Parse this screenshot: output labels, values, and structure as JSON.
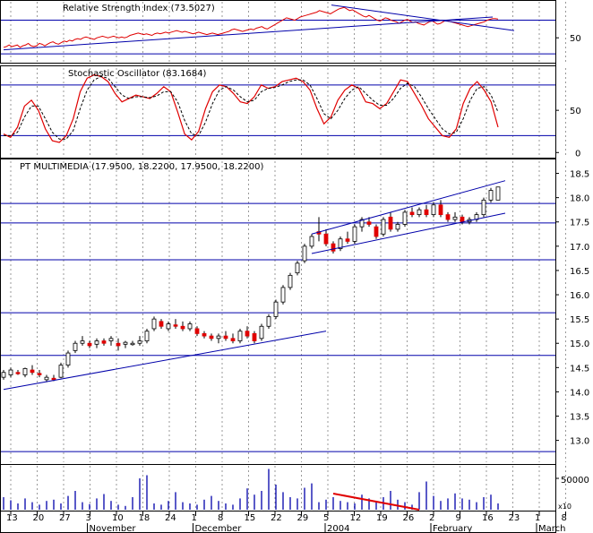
{
  "chart_data": {
    "type": "candlestick",
    "panels": {
      "rsi": {
        "title": "Relative Strength Index (73.5027)",
        "ylim": [
          20,
          95
        ],
        "ticks": [
          50
        ],
        "hlines": [
          72,
          30
        ],
        "values": [
          38,
          39,
          41,
          39,
          40,
          41,
          38,
          40,
          41,
          43,
          40,
          39,
          40,
          43,
          42,
          40,
          42,
          44,
          45,
          43,
          42,
          44,
          46,
          45,
          47,
          46,
          48,
          49,
          48,
          50,
          51,
          50,
          49,
          48,
          50,
          51,
          52,
          51,
          50,
          51,
          52,
          51,
          50,
          51,
          50,
          51,
          53,
          54,
          55,
          56,
          55,
          54,
          55,
          54,
          53,
          55,
          56,
          55,
          56,
          57,
          56,
          57,
          58,
          59,
          58,
          57,
          58,
          57,
          56,
          55,
          56,
          57,
          56,
          55,
          54,
          55,
          56,
          55,
          54,
          55,
          56,
          57,
          58,
          60,
          61,
          60,
          59,
          58,
          59,
          60,
          61,
          60,
          62,
          63,
          64,
          62,
          61,
          63,
          65,
          67,
          69,
          71,
          73,
          75,
          74,
          73,
          72,
          74,
          76,
          77,
          78,
          79,
          80,
          81,
          82,
          84,
          83,
          82,
          81,
          80,
          82,
          84,
          86,
          87,
          88,
          86,
          84,
          85,
          83,
          81,
          79,
          77,
          76,
          78,
          76,
          74,
          72,
          71,
          73,
          75,
          74,
          72,
          71,
          70,
          68,
          70,
          72,
          73,
          71,
          69,
          70,
          68,
          67,
          66,
          68,
          70,
          71,
          69,
          67,
          68,
          70,
          72,
          71,
          70,
          69,
          68,
          67,
          66,
          65,
          64,
          65,
          66,
          67,
          68,
          69,
          70,
          72,
          73,
          74,
          74,
          73.5
        ]
      },
      "stochastic": {
        "title": "Stochastic Oscillator (83.1684)",
        "ylim": [
          -5,
          100
        ],
        "ticks": [
          50,
          0
        ],
        "hlines": [
          80,
          20
        ],
        "k": [
          22,
          18,
          30,
          55,
          62,
          50,
          28,
          14,
          12,
          20,
          40,
          72,
          88,
          92,
          90,
          84,
          70,
          60,
          64,
          68,
          66,
          64,
          70,
          78,
          72,
          48,
          22,
          15,
          25,
          52,
          72,
          80,
          78,
          70,
          60,
          58,
          66,
          80,
          76,
          78,
          84,
          86,
          88,
          84,
          74,
          52,
          34,
          42,
          62,
          74,
          80,
          76,
          60,
          58,
          52,
          58,
          72,
          86,
          84,
          70,
          56,
          40,
          30,
          20,
          18,
          28,
          58,
          76,
          84,
          74,
          60,
          30
        ],
        "d": [
          20,
          20,
          24,
          42,
          55,
          55,
          40,
          24,
          16,
          16,
          26,
          52,
          74,
          86,
          90,
          88,
          78,
          68,
          64,
          66,
          66,
          65,
          67,
          72,
          72,
          60,
          38,
          22,
          20,
          36,
          58,
          74,
          78,
          74,
          66,
          60,
          62,
          72,
          76,
          77,
          80,
          84,
          86,
          86,
          80,
          64,
          46,
          40,
          50,
          64,
          74,
          78,
          70,
          62,
          56,
          56,
          64,
          76,
          82,
          78,
          66,
          52,
          40,
          28,
          22,
          24,
          40,
          62,
          76,
          78,
          68,
          48
        ]
      },
      "price": {
        "title": "PT MULTIMEDIA (17.9500, 18.2200, 17.9500, 18.2200)",
        "ylim": [
          12.55,
          18.75
        ],
        "ticks": [
          18.5,
          18.0,
          17.5,
          17.0,
          16.5,
          16.0,
          15.5,
          15.0,
          14.5,
          14.0,
          13.5,
          13.0
        ],
        "hlines": [
          17.88,
          17.48,
          16.72,
          15.63,
          14.75,
          12.77
        ],
        "ohlc": [
          [
            14.3,
            14.45,
            14.25,
            14.4
          ],
          [
            14.35,
            14.5,
            14.3,
            14.45
          ],
          [
            14.4,
            14.45,
            14.35,
            14.38
          ],
          [
            14.35,
            14.5,
            14.3,
            14.48
          ],
          [
            14.45,
            14.55,
            14.35,
            14.4
          ],
          [
            14.38,
            14.45,
            14.3,
            14.35
          ],
          [
            14.25,
            14.35,
            14.2,
            14.3
          ],
          [
            14.28,
            14.35,
            14.22,
            14.25
          ],
          [
            14.3,
            14.6,
            14.28,
            14.55
          ],
          [
            14.55,
            14.85,
            14.5,
            14.8
          ],
          [
            14.85,
            15.05,
            14.8,
            15.0
          ],
          [
            15.0,
            15.15,
            14.95,
            15.05
          ],
          [
            15.0,
            15.05,
            14.9,
            14.95
          ],
          [
            14.98,
            15.1,
            14.9,
            15.05
          ],
          [
            15.05,
            15.1,
            14.95,
            15.0
          ],
          [
            15.05,
            15.15,
            14.95,
            15.1
          ],
          [
            15.0,
            15.1,
            14.85,
            14.95
          ],
          [
            14.98,
            15.05,
            14.9,
            15.02
          ],
          [
            15.0,
            15.05,
            14.95,
            15.0
          ],
          [
            15.0,
            15.15,
            14.95,
            15.05
          ],
          [
            15.05,
            15.3,
            15.0,
            15.25
          ],
          [
            15.3,
            15.55,
            15.25,
            15.5
          ],
          [
            15.45,
            15.5,
            15.3,
            15.35
          ],
          [
            15.3,
            15.45,
            15.25,
            15.4
          ],
          [
            15.38,
            15.5,
            15.3,
            15.35
          ],
          [
            15.35,
            15.45,
            15.25,
            15.3
          ],
          [
            15.3,
            15.45,
            15.25,
            15.4
          ],
          [
            15.3,
            15.35,
            15.15,
            15.2
          ],
          [
            15.2,
            15.25,
            15.1,
            15.15
          ],
          [
            15.15,
            15.2,
            15.05,
            15.1
          ],
          [
            15.1,
            15.2,
            15.0,
            15.15
          ],
          [
            15.15,
            15.25,
            15.05,
            15.1
          ],
          [
            15.1,
            15.2,
            15.0,
            15.05
          ],
          [
            15.05,
            15.3,
            15.0,
            15.25
          ],
          [
            15.25,
            15.35,
            15.1,
            15.15
          ],
          [
            15.2,
            15.25,
            15.0,
            15.05
          ],
          [
            15.1,
            15.4,
            15.05,
            15.35
          ],
          [
            15.35,
            15.6,
            15.3,
            15.55
          ],
          [
            15.55,
            15.9,
            15.5,
            15.85
          ],
          [
            15.85,
            16.2,
            15.8,
            16.15
          ],
          [
            16.15,
            16.45,
            16.1,
            16.4
          ],
          [
            16.45,
            16.7,
            16.4,
            16.65
          ],
          [
            16.7,
            17.05,
            16.65,
            17.0
          ],
          [
            17.0,
            17.25,
            16.95,
            17.2
          ],
          [
            17.3,
            17.6,
            17.1,
            17.25
          ],
          [
            17.25,
            17.35,
            17.0,
            17.05
          ],
          [
            17.05,
            17.1,
            16.85,
            16.9
          ],
          [
            16.95,
            17.2,
            16.9,
            17.15
          ],
          [
            17.15,
            17.3,
            17.05,
            17.1
          ],
          [
            17.1,
            17.45,
            17.05,
            17.4
          ],
          [
            17.4,
            17.6,
            17.3,
            17.55
          ],
          [
            17.5,
            17.6,
            17.4,
            17.45
          ],
          [
            17.4,
            17.45,
            17.15,
            17.2
          ],
          [
            17.25,
            17.6,
            17.2,
            17.55
          ],
          [
            17.6,
            17.7,
            17.3,
            17.35
          ],
          [
            17.35,
            17.5,
            17.3,
            17.45
          ],
          [
            17.45,
            17.75,
            17.4,
            17.7
          ],
          [
            17.7,
            17.8,
            17.6,
            17.65
          ],
          [
            17.65,
            17.8,
            17.6,
            17.75
          ],
          [
            17.75,
            17.85,
            17.6,
            17.65
          ],
          [
            17.65,
            17.9,
            17.6,
            17.85
          ],
          [
            17.85,
            17.95,
            17.6,
            17.65
          ],
          [
            17.65,
            17.7,
            17.5,
            17.55
          ],
          [
            17.55,
            17.7,
            17.5,
            17.6
          ],
          [
            17.6,
            17.65,
            17.45,
            17.5
          ],
          [
            17.5,
            17.6,
            17.45,
            17.55
          ],
          [
            17.55,
            17.7,
            17.5,
            17.65
          ],
          [
            17.65,
            18.0,
            17.6,
            17.95
          ],
          [
            17.95,
            18.2,
            17.9,
            18.15
          ],
          [
            17.95,
            18.22,
            17.95,
            18.22
          ]
        ],
        "trendlines": [
          {
            "from": [
              0,
              14.05
            ],
            "to": [
              45,
              15.25
            ]
          },
          {
            "from": [
              43,
              17.25
            ],
            "to": [
              70,
              18.35
            ]
          },
          {
            "from": [
              43,
              16.85
            ],
            "to": [
              70,
              17.68
            ]
          }
        ]
      },
      "volume": {
        "tick": "50000",
        "unit": "x10",
        "values": [
          20,
          15,
          10,
          18,
          12,
          8,
          14,
          16,
          10,
          22,
          30,
          12,
          9,
          18,
          25,
          14,
          8,
          6,
          20,
          50,
          55,
          10,
          8,
          14,
          28,
          12,
          10,
          8,
          16,
          22,
          14,
          10,
          8,
          18,
          34,
          24,
          30,
          65,
          40,
          28,
          20,
          18,
          35,
          42,
          12,
          16,
          20,
          14,
          12,
          10,
          24,
          18,
          14,
          20,
          30,
          16,
          12,
          8,
          28,
          45,
          22,
          14,
          18,
          26,
          18,
          16,
          12,
          20,
          24,
          10
        ]
      }
    },
    "x_labels": [
      "13",
      "20",
      "27",
      "3",
      "10",
      "18",
      "24",
      "1",
      "8",
      "15",
      "22",
      "29",
      "5",
      "12",
      "19",
      "26",
      "2",
      "9",
      "16",
      "23",
      "1",
      "8"
    ],
    "month_labels": [
      "November",
      "December",
      "2004",
      "February",
      "March"
    ]
  }
}
